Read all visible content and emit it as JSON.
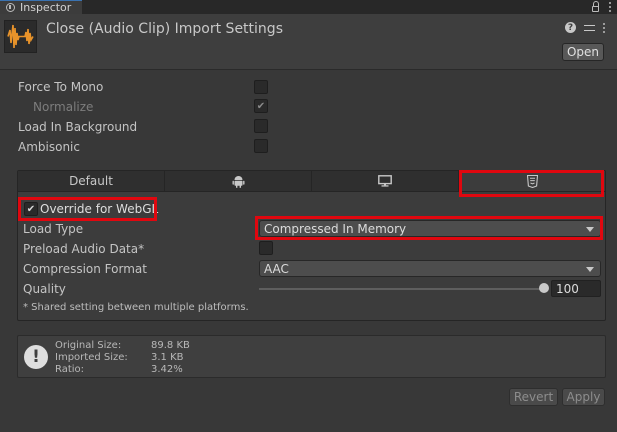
{
  "window": {
    "tab_label": "Inspector"
  },
  "header": {
    "title": "Close (Audio Clip) Import Settings",
    "open_label": "Open"
  },
  "properties": [
    {
      "label": "Force To Mono",
      "checked": false
    },
    {
      "label": "Normalize",
      "checked": true,
      "disabled": true
    },
    {
      "label": "Load In Background",
      "checked": false
    },
    {
      "label": "Ambisonic",
      "checked": false
    }
  ],
  "platform_tabs": [
    {
      "label": "Default",
      "icon": ""
    },
    {
      "label": "",
      "icon": "android-icon"
    },
    {
      "label": "",
      "icon": "desktop-icon"
    },
    {
      "label": "",
      "icon": "html5-icon",
      "selected": true
    }
  ],
  "platform": {
    "override_label": "Override for WebGL",
    "override_checked": true,
    "load_type": {
      "label": "Load Type",
      "value": "Compressed In Memory"
    },
    "preload": {
      "label": "Preload Audio Data*",
      "checked": false
    },
    "compression": {
      "label": "Compression Format",
      "value": "AAC"
    },
    "quality": {
      "label": "Quality",
      "value": "100",
      "fraction": 1.0
    },
    "note": "* Shared setting between multiple platforms."
  },
  "info": {
    "original_label": "Original Size:",
    "original_value": "89.8 KB",
    "imported_label": "Imported Size:",
    "imported_value": "3.1 KB",
    "ratio_label": "Ratio:",
    "ratio_value": "3.42%"
  },
  "footer": {
    "revert_label": "Revert",
    "apply_label": "Apply"
  },
  "colors": {
    "highlight": "#e0070f",
    "background": "#383838",
    "accent_orange": "#e8932a"
  }
}
